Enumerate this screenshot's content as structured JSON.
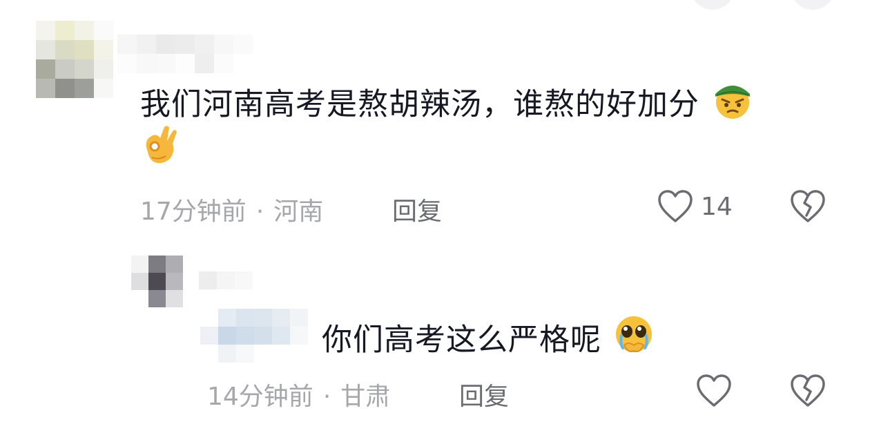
{
  "comments": [
    {
      "text": "我们河南高考是熬胡辣汤，谁熬的好加分",
      "emojis": [
        "angry-green-hat-emoji",
        "ok-hand-emoji"
      ],
      "time": "17分钟前",
      "location": "河南",
      "reply_label": "回复",
      "like_count": "14",
      "icons": [
        "heart-icon",
        "broken-heart-icon"
      ]
    },
    {
      "text": "你们高考这么严格呢",
      "emojis": [
        "crying-pleading-emoji"
      ],
      "time": "14分钟前",
      "location": "甘肃",
      "reply_label": "回复",
      "icons": [
        "heart-icon",
        "broken-heart-icon"
      ]
    }
  ],
  "separator": "·"
}
